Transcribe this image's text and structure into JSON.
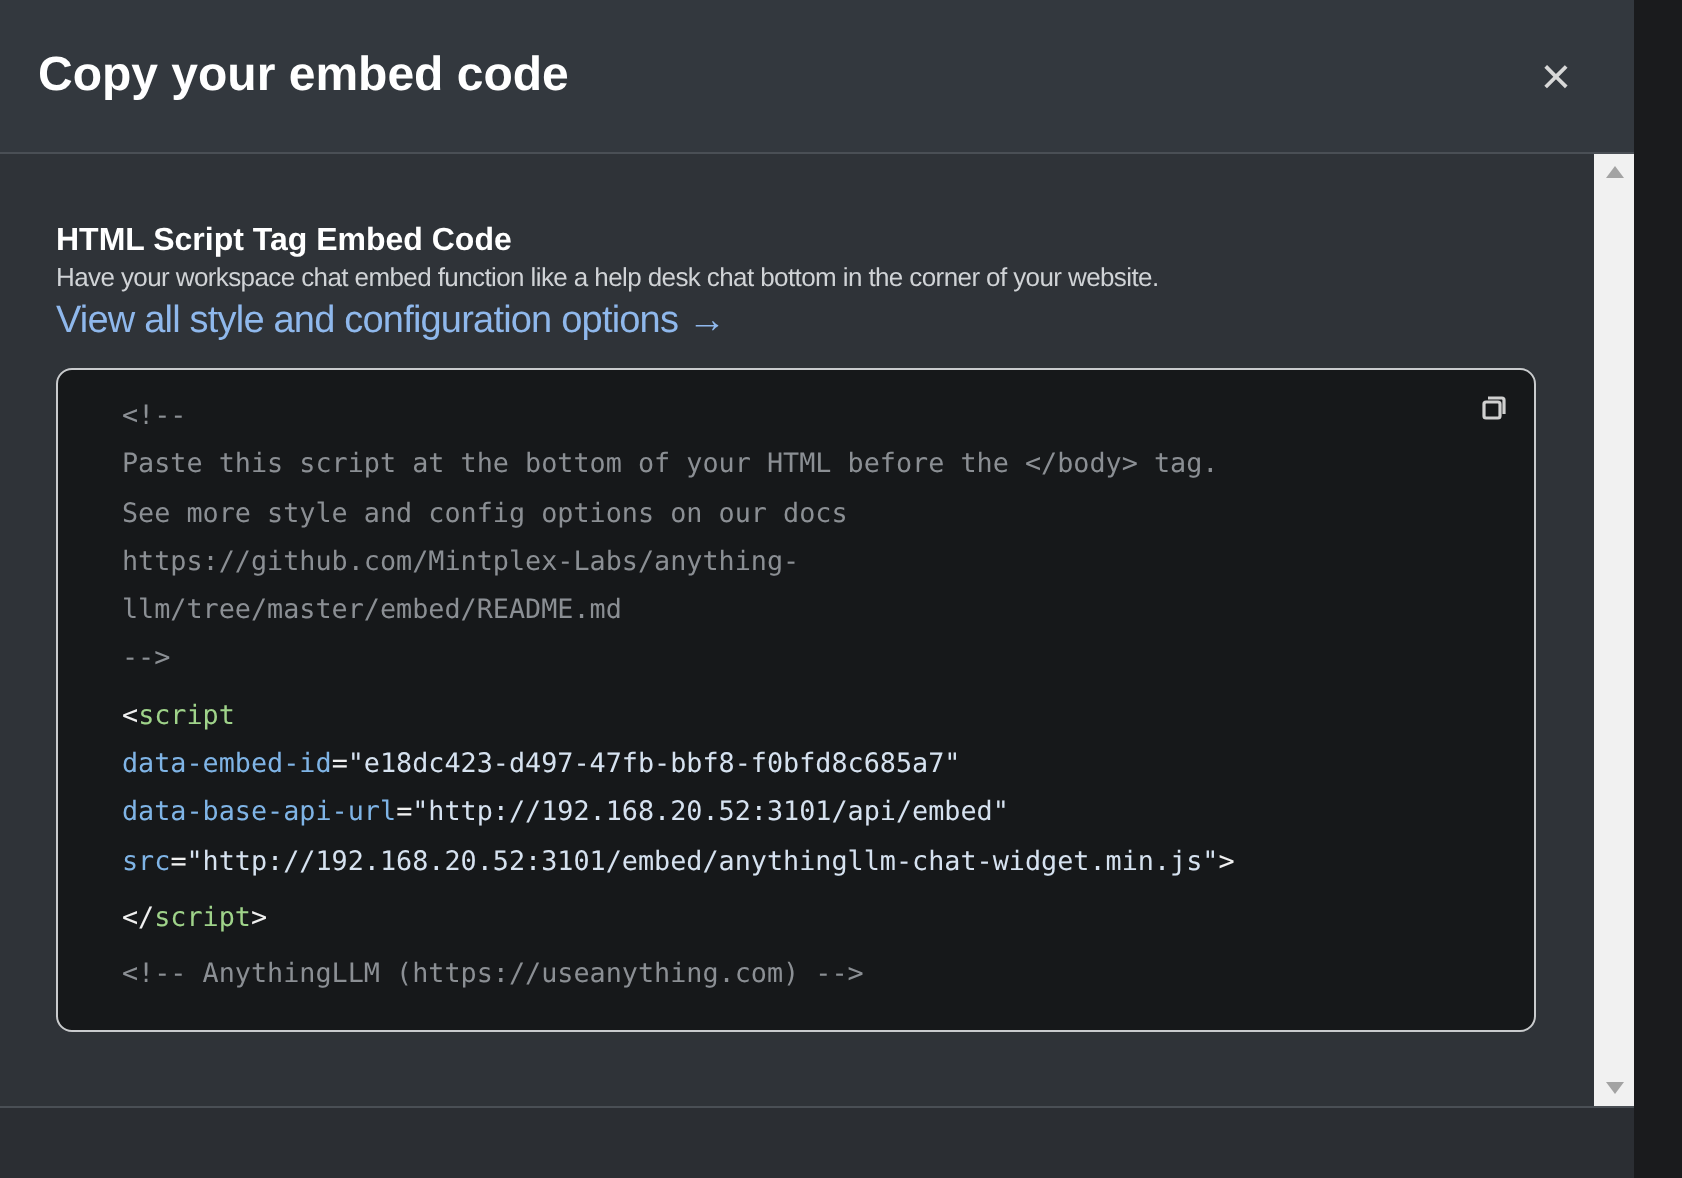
{
  "modal": {
    "title": "Copy your embed code",
    "close_icon": "×"
  },
  "section": {
    "heading": "HTML Script Tag Embed Code",
    "description": "Have your workspace chat embed function like a help desk chat bottom in the corner of your website.",
    "link": "View all style and configuration options →"
  },
  "code_lines": [
    {
      "tokens": [
        {
          "kind": "comment",
          "text": "<!--"
        }
      ]
    },
    {
      "tokens": [
        {
          "kind": "comment",
          "text": "Paste this script at the bottom of your HTML before the </body> tag."
        }
      ]
    },
    {
      "tokens": [
        {
          "kind": "comment",
          "text": "See more style and config options on our docs"
        }
      ]
    },
    {
      "tokens": [
        {
          "kind": "comment",
          "text": "https://github.com/Mintplex-Labs/anything-"
        }
      ]
    },
    {
      "tokens": [
        {
          "kind": "comment",
          "text": "llm/tree/master/embed/README.md"
        }
      ]
    },
    {
      "tokens": [
        {
          "kind": "comment",
          "text": "-->"
        }
      ]
    },
    {
      "tokens": [
        {
          "kind": "punct",
          "text": "<"
        },
        {
          "kind": "tag",
          "text": "script"
        }
      ]
    },
    {
      "tokens": [
        {
          "kind": "attr",
          "text": "data-embed-id"
        },
        {
          "kind": "punct",
          "text": "="
        },
        {
          "kind": "string",
          "text": "\"e18dc423-d497-47fb-bbf8-f0bfd8c685a7\""
        }
      ]
    },
    {
      "tokens": [
        {
          "kind": "attr",
          "text": "data-base-api-url"
        },
        {
          "kind": "punct",
          "text": "="
        },
        {
          "kind": "string",
          "text": "\"http://192.168.20.52:3101/api/embed\""
        }
      ]
    },
    {
      "tokens": [
        {
          "kind": "attr",
          "text": "src"
        },
        {
          "kind": "punct",
          "text": "="
        },
        {
          "kind": "string",
          "text": "\"http://192.168.20.52:3101/embed/anythingllm-chat-widget.min.js\""
        },
        {
          "kind": "punct",
          "text": ">"
        }
      ]
    },
    {
      "tokens": [
        {
          "kind": "punct",
          "text": "</"
        },
        {
          "kind": "tag",
          "text": "script"
        },
        {
          "kind": "punct",
          "text": ">"
        }
      ]
    },
    {
      "tokens": [
        {
          "kind": "comment",
          "text": "<!-- AnythingLLM (https://useanything.com) -->"
        }
      ]
    }
  ]
}
